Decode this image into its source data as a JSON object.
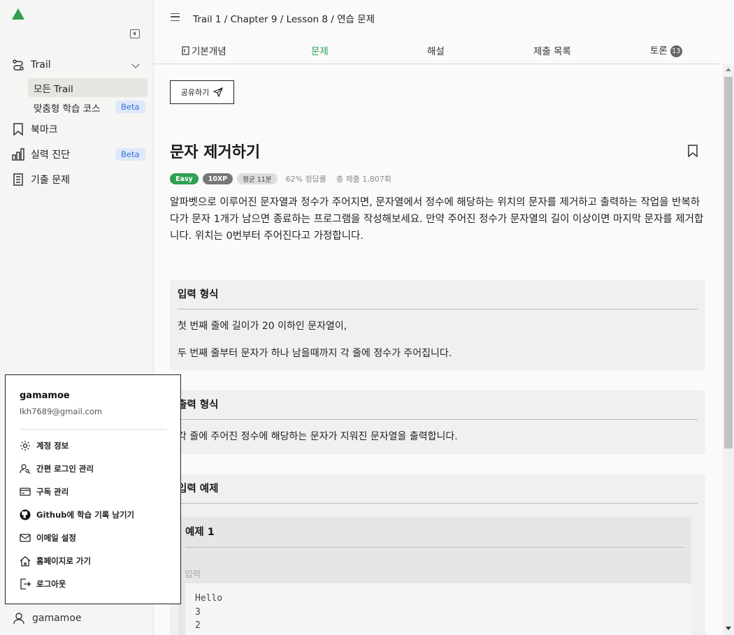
{
  "topbar": {
    "breadcrumb": "Trail 1 / Chapter 9 / Lesson 8 / 연습 문제"
  },
  "sidebar": {
    "items": [
      {
        "label": "Trail",
        "icon": "trail-icon"
      },
      {
        "label": "북마크",
        "icon": "bookmark-icon"
      },
      {
        "label": "실력 진단",
        "icon": "bar-chart-icon",
        "badge": "Beta"
      },
      {
        "label": "기출 문제",
        "icon": "document-icon"
      }
    ],
    "sub_items": [
      {
        "label": "모든 Trail",
        "active": true
      },
      {
        "label": "맞춤형 학습 코스",
        "badge": "Beta"
      }
    ],
    "user": "gamamoe"
  },
  "tabs": [
    {
      "label": "기본개념",
      "icon": "book-icon"
    },
    {
      "label": "문제",
      "active": true
    },
    {
      "label": "해설"
    },
    {
      "label": "제출 목록"
    },
    {
      "label": "토론",
      "badge": "13"
    }
  ],
  "problem": {
    "share_label": "공유하기",
    "title": "문자 제거하기",
    "difficulty": "Easy",
    "xp": "10XP",
    "avg_time": "평균 11분",
    "accuracy": "62% 정답률",
    "submissions": "총 제출 1,807회",
    "description": "알파벳으로 이루어진 문자열과 정수가 주어지면, 문자열에서 정수에 해당하는 위치의 문자를 제거하고 출력하는 작업을 반복하다가 문자 1개가 남으면 종료하는 프로그램을 작성해보세요. 만약 주어진 정수가 문자열의 길이 이상이면 마지막 문자를 제거합니다. 위치는 0번부터 주어진다고 가정합니다."
  },
  "input_format": {
    "heading": "입력 형식",
    "lines": [
      "첫 번째 줄에 길이가 20 이하인 문자열이,",
      "두 번째 줄부터 문자가 하나 남을때까지 각 줄에 정수가 주어집니다."
    ]
  },
  "output_format": {
    "heading": "출력 형식",
    "lines": [
      "각 줄에 주어진 정수에 해당하는 문자가 지워진 문자열을 출력합니다."
    ]
  },
  "examples": {
    "heading": "입력 예제",
    "example_title": "예제 1",
    "input_label": "입력",
    "input_code": "Hello\n3\n2"
  },
  "popup": {
    "username": "gamamoe",
    "email": "lkh7689@gmail.com",
    "menu": [
      {
        "label": "계정 정보",
        "icon": "gear-icon"
      },
      {
        "label": "간편 로그인 관리",
        "icon": "user-key-icon"
      },
      {
        "label": "구독 관리",
        "icon": "credit-card-icon"
      },
      {
        "label": "Github에 학습 기록 남기기",
        "icon": "github-icon"
      },
      {
        "label": "이메일 설정",
        "icon": "mail-icon"
      },
      {
        "label": "홈페이지로 가기",
        "icon": "home-icon"
      },
      {
        "label": "로그아웃",
        "icon": "logout-icon"
      }
    ]
  },
  "colors": {
    "accent": "#2ea04f",
    "beta_bg": "#dde9fb",
    "beta_text": "#3b6fd1"
  }
}
